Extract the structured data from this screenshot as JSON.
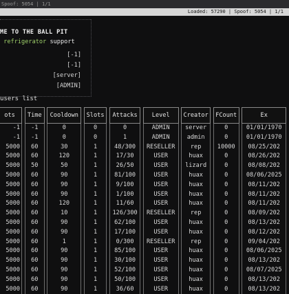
{
  "titlebar": {
    "text": "Spoof: 5054 | 1/1"
  },
  "statusbar": {
    "text": "Loaded: 57290 | Spoof: 5054 | 1/1"
  },
  "banner": {
    "line1": "ME TO THE BALL PIT",
    "line2_prefix": " ",
    "line2_green": "refrigerator",
    "line2_suffix": " support"
  },
  "info_rows": [
    "[-1]",
    "[-1]",
    "[server]",
    "[ADMIN]"
  ],
  "users_label": "users list",
  "table": {
    "headers": [
      "ots",
      "Time",
      "Cooldown",
      "Slots",
      "Attacks",
      "Level",
      "Creator",
      "FCount",
      "Ex"
    ],
    "rows": [
      [
        "-1",
        "-1",
        "0",
        "0",
        "0",
        "ADMIN",
        "server",
        "0",
        "01/01/1970"
      ],
      [
        "-1",
        "-1",
        "0",
        "0",
        "1",
        "ADMIN",
        "admin",
        "0",
        "01/01/1970"
      ],
      [
        "5000",
        "60",
        "30",
        "1",
        "48/300",
        "RESELLER",
        "rep",
        "10000",
        "08/25/202"
      ],
      [
        "5000",
        "60",
        "120",
        "1",
        "17/30",
        "USER",
        "huax",
        "0",
        "08/26/202"
      ],
      [
        "5000",
        "50",
        "50",
        "1",
        "26/50",
        "USER",
        "lizard",
        "0",
        "08/08/202"
      ],
      [
        "5000",
        "60",
        "90",
        "1",
        "81/100",
        "USER",
        "huax",
        "0",
        "08/06/2025"
      ],
      [
        "5000",
        "60",
        "90",
        "1",
        "9/100",
        "USER",
        "huax",
        "0",
        "08/11/202"
      ],
      [
        "5000",
        "60",
        "90",
        "1",
        "1/100",
        "USER",
        "huax",
        "0",
        "08/11/202"
      ],
      [
        "5000",
        "60",
        "120",
        "1",
        "11/60",
        "USER",
        "huax",
        "0",
        "08/11/202"
      ],
      [
        "5000",
        "60",
        "10",
        "1",
        "126/300",
        "RESELLER",
        "rep",
        "0",
        "08/09/202"
      ],
      [
        "5000",
        "60",
        "90",
        "1",
        "62/100",
        "USER",
        "huax",
        "0",
        "08/13/202"
      ],
      [
        "5000",
        "60",
        "90",
        "1",
        "17/100",
        "USER",
        "huax",
        "0",
        "08/12/202"
      ],
      [
        "5000",
        "60",
        "1",
        "1",
        "0/300",
        "RESELLER",
        "rep",
        "0",
        "09/04/202"
      ],
      [
        "5000",
        "60",
        "90",
        "1",
        "85/100",
        "USER",
        "huax",
        "0",
        "08/06/2025"
      ],
      [
        "5000",
        "60",
        "90",
        "1",
        "30/100",
        "USER",
        "huax",
        "0",
        "08/13/202"
      ],
      [
        "5000",
        "60",
        "90",
        "1",
        "52/100",
        "USER",
        "huax",
        "0",
        "08/07/2025"
      ],
      [
        "5000",
        "60",
        "90",
        "1",
        "50/100",
        "USER",
        "huax",
        "0",
        "08/13/202"
      ],
      [
        "5000",
        "60",
        "90",
        "1",
        "36/60",
        "USER",
        "huax",
        "0",
        "08/13/202"
      ]
    ]
  }
}
